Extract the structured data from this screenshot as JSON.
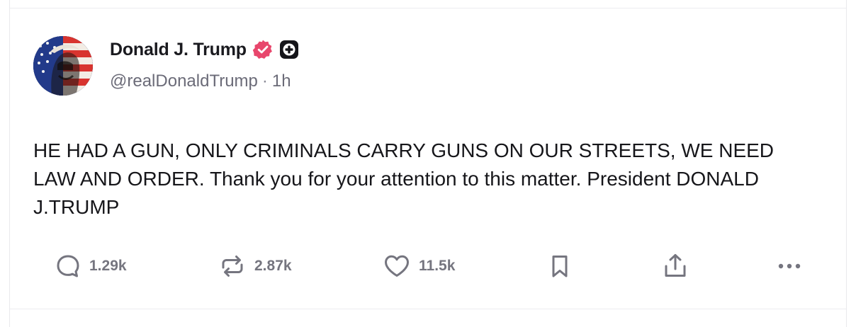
{
  "author": {
    "display_name": "Donald J. Trump",
    "handle": "@realDonaldTrump",
    "separator": "·",
    "time": "1h",
    "verified_badge_icon": "verified-badge-icon",
    "plus_badge_icon": "plus-badge-icon",
    "verified_color": "#e8466c"
  },
  "post": {
    "text": "HE HAD A GUN, ONLY CRIMINALS CARRY GUNS ON OUR STREETS, WE NEED LAW AND ORDER. Thank you for your attention to this matter. President DONALD J.TRUMP"
  },
  "actions": {
    "replies": {
      "icon": "reply-icon",
      "count": "1.29k"
    },
    "reposts": {
      "icon": "repost-icon",
      "count": "2.87k"
    },
    "likes": {
      "icon": "heart-icon",
      "count": "11.5k"
    },
    "bookmark": {
      "icon": "bookmark-icon"
    },
    "share": {
      "icon": "share-icon"
    },
    "more": {
      "icon": "more-icon"
    }
  }
}
